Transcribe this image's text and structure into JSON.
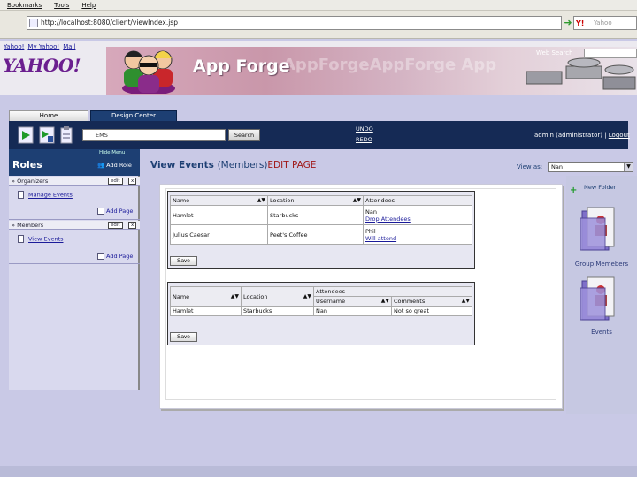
{
  "browser": {
    "menu": [
      "Bookmarks",
      "Tools",
      "Help"
    ],
    "url": "http://localhost:8080/client/viewIndex.jsp",
    "search_placeholder": "Yahoo",
    "search_logo": "Y!"
  },
  "header": {
    "yahoo_links": [
      "Yahoo!",
      "My Yahoo!",
      "Mail"
    ],
    "yahoo_logo": "YAHOO!",
    "brand": "App Forge",
    "brand_ghost": "AppForgeAppForge App",
    "web_search_label": "Web Search"
  },
  "tabs": {
    "home": "Home",
    "design_center": "Design Center"
  },
  "toolbar": {
    "site_select": "EMS",
    "search": "Search",
    "undo": "UNDO",
    "redo": "REDO",
    "user": "admin (administrator) |",
    "logout": "Logout"
  },
  "sidebar": {
    "hide_menu": "Hide Menu",
    "title": "Roles",
    "add_role": "Add Role",
    "groups": [
      {
        "name": "Organizers",
        "edit": "edit",
        "x": "x",
        "items": [
          "Manage Events"
        ],
        "add_page": "Add Page"
      },
      {
        "name": "Members",
        "edit": "edit",
        "x": "x",
        "items": [
          "View Events"
        ],
        "add_page": "Add Page"
      }
    ]
  },
  "main": {
    "title": "View Events",
    "role": "(Members)",
    "edit_page": "EDIT PAGE",
    "view_as_label": "View as:",
    "view_as_value": "Nan"
  },
  "table1": {
    "headers": [
      "Name",
      "Location",
      "Attendees"
    ],
    "sort": "▲▼",
    "rows": [
      {
        "name": "Hamlet",
        "location": "Starbucks",
        "attendees": [
          "Nan",
          "Drop Attendees"
        ]
      },
      {
        "name": "Julius Caesar",
        "location": "Peet's Coffee",
        "attendees": [
          "Phil",
          "Will attend"
        ]
      }
    ],
    "save": "Save"
  },
  "table2": {
    "headers": [
      "Name",
      "Location",
      "Attendees"
    ],
    "sub_headers": [
      "Username",
      "Comments"
    ],
    "sort": "▲▼",
    "rows": [
      {
        "name": "Hamlet",
        "location": "Starbucks",
        "username": "Nan",
        "comment": "Not so great"
      }
    ],
    "save": "Save"
  },
  "right_panel": {
    "new_folder": "New Folder",
    "folders": [
      "Group Memebers",
      "Events"
    ]
  },
  "colors": {
    "nav_dark": "#152a55",
    "accent_blue": "#1d3f73",
    "edit_red": "#a01818"
  }
}
